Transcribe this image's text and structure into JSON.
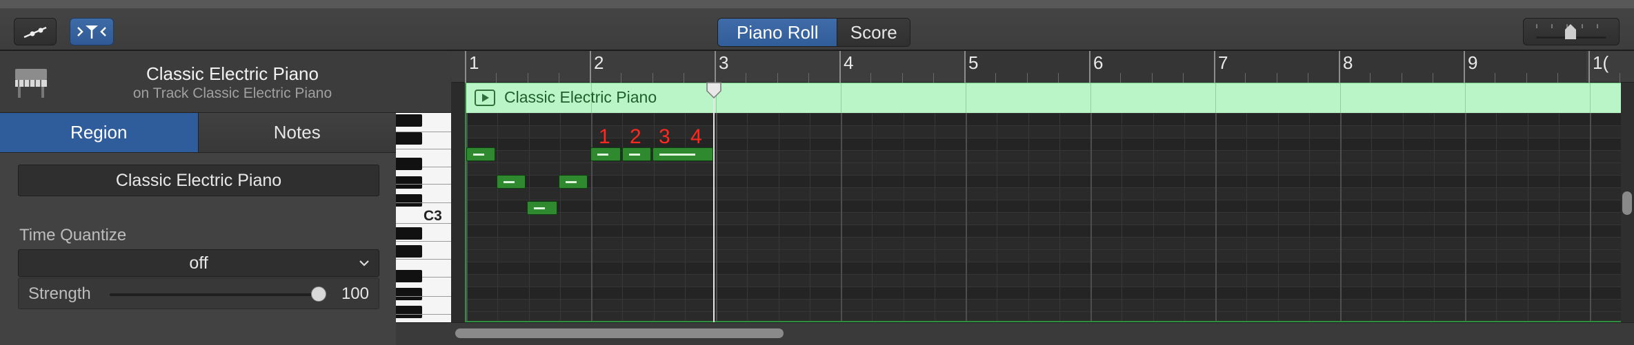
{
  "toolbar": {
    "segments": [
      {
        "label": "Piano Roll",
        "active": true
      },
      {
        "label": "Score",
        "active": false
      }
    ],
    "automation_icon": "automation-curve-icon",
    "catch_icon": "catch-playhead-icon",
    "zoom_icon": "zoom-slider-icon"
  },
  "inspector": {
    "instrument_name": "Classic Electric Piano",
    "track_subtitle": "on Track Classic Electric Piano",
    "instrument_icon": "electric-piano-icon",
    "tabs": [
      {
        "label": "Region",
        "active": true
      },
      {
        "label": "Notes",
        "active": false
      }
    ],
    "region_name": "Classic Electric Piano",
    "time_quantize_label": "Time Quantize",
    "time_quantize_value": "off",
    "strength_label": "Strength",
    "strength_value": "100"
  },
  "keyboard": {
    "c3_label": "C3"
  },
  "editor": {
    "bars": [
      "1",
      "2",
      "3",
      "4",
      "5",
      "6",
      "7",
      "8",
      "9",
      "1("
    ],
    "region_title": "Classic Electric Piano",
    "markers": [
      "1",
      "2",
      "3",
      "4"
    ],
    "colors": {
      "region": "#b9f5c6",
      "note": "#2f8a2f",
      "marker": "#ff2a1f",
      "selected_blue": "#2f5c9a"
    }
  }
}
